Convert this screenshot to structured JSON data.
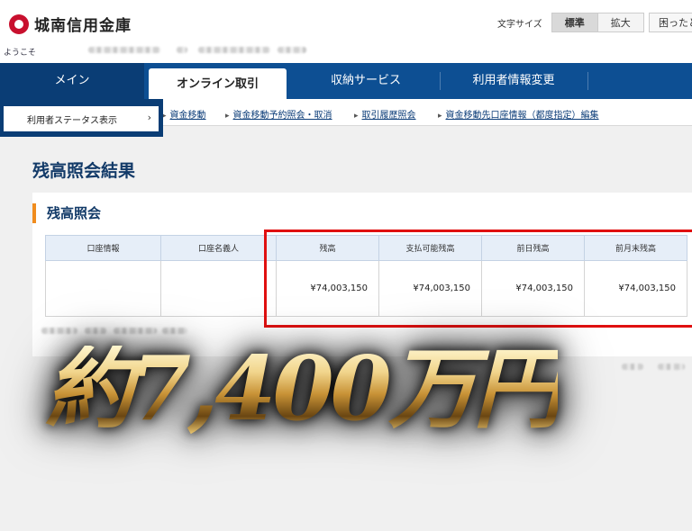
{
  "header": {
    "bank_name": "城南信用金庫",
    "font_size_label": "文字サイズ",
    "font_size_options": [
      "標準",
      "拡大"
    ],
    "font_size_selected": "標準",
    "help_label": "困ったと",
    "welcome": "ようこそ"
  },
  "nav": {
    "tabs": [
      {
        "label": "メイン"
      },
      {
        "label": "オンライン取引",
        "active": true
      },
      {
        "label": "収納サービス"
      },
      {
        "label": "利用者情報変更"
      }
    ],
    "dropdown_item": "利用者ステータス表示",
    "sub_items": [
      {
        "label": "資金移動"
      },
      {
        "label": "資金移動予約照会・取消"
      },
      {
        "label": "取引履歴照会"
      },
      {
        "label": "資金移動先口座情報（都度指定）編集"
      }
    ]
  },
  "page": {
    "title": "残高照会結果",
    "section_title": "残高照会"
  },
  "table": {
    "headers": [
      "口座情報",
      "口座名義人",
      "残高",
      "支払可能残高",
      "前日残高",
      "前月末残高"
    ],
    "row": [
      "",
      "",
      "¥74,003,150",
      "¥74,003,150",
      "¥74,003,150",
      "¥74,003,150"
    ]
  },
  "overlay": {
    "text": "約7,400万円"
  },
  "colors": {
    "nav_blue": "#0d4f93",
    "title_blue": "#123a68",
    "accent_orange": "#f08c1e",
    "highlight_red": "#e01010"
  }
}
